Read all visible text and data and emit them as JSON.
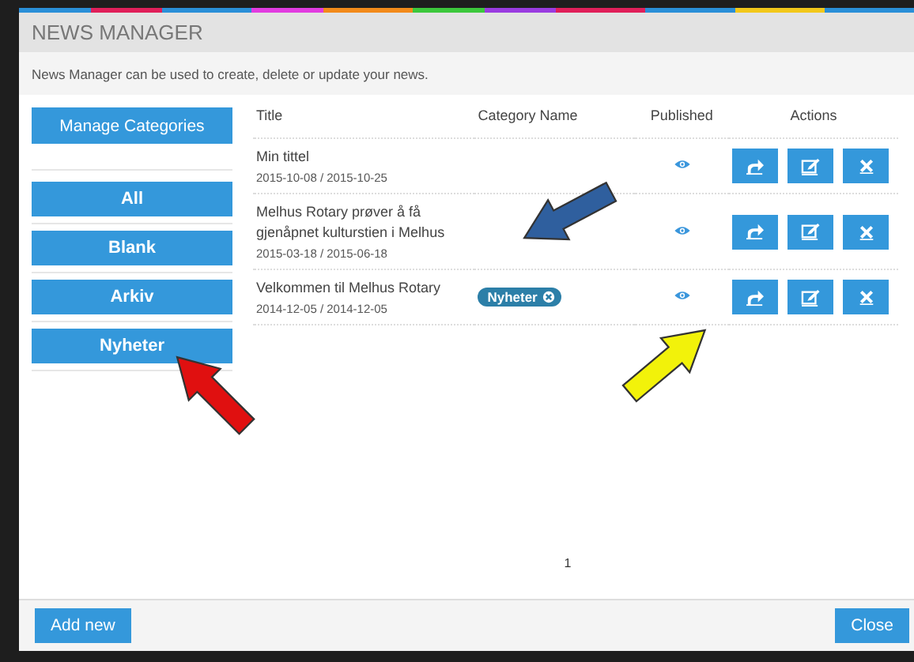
{
  "window": {
    "title": "NEWS MANAGER"
  },
  "description": "News Manager can be used to create, delete or update your news.",
  "sidebar": {
    "manage_button": "Manage Categories",
    "categories": [
      {
        "label": "All"
      },
      {
        "label": "Blank"
      },
      {
        "label": "Arkiv"
      },
      {
        "label": "Nyheter"
      }
    ]
  },
  "table": {
    "columns": [
      "Title",
      "Category Name",
      "Published",
      "Actions"
    ],
    "rows": [
      {
        "title": "Min tittel",
        "dates": "2015-10-08 / 2015-10-25",
        "published": true
      },
      {
        "title": "Melhus Rotary prøver å få gjenåpnet kulturstien i Melhus",
        "dates": "2015-03-18 / 2015-06-18",
        "published": true
      },
      {
        "title": "Velkommen til Melhus Rotary",
        "dates": "2014-12-05 / 2014-12-05",
        "category": "Nyheter",
        "published": true
      }
    ]
  },
  "pagination": [
    "1"
  ],
  "footer": {
    "add_button": "Add new",
    "close_button": "Close"
  },
  "annotations": [
    {
      "kind": "arrow",
      "color": "#2f5f9e"
    },
    {
      "kind": "arrow",
      "color": "#e01010"
    },
    {
      "kind": "arrow",
      "color": "#f2f20a"
    }
  ]
}
